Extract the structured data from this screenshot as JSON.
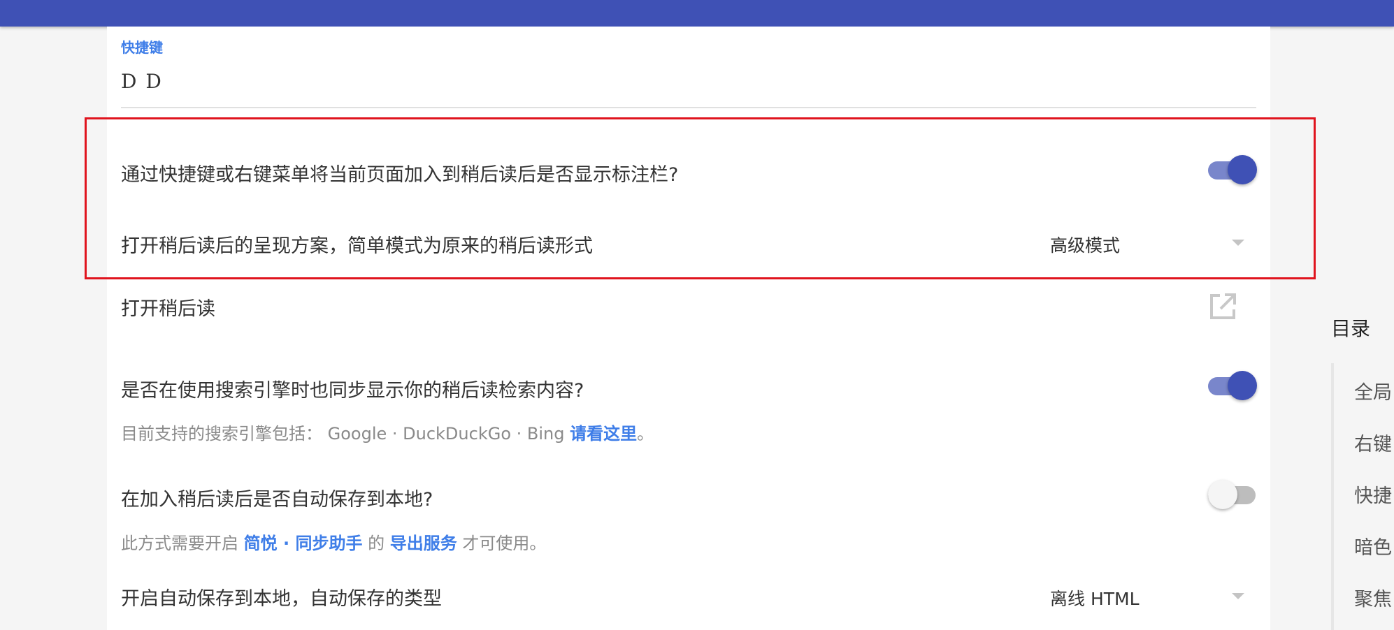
{
  "colors": {
    "header": "#3f51b5",
    "accent": "#3f7ee8",
    "highlight_border": "#e0141e",
    "toggle_on": "#3f51b5"
  },
  "shortcut": {
    "label": "快捷键",
    "value": "D D"
  },
  "settings": {
    "show_annotation_bar": {
      "label": "通过快捷键或右键菜单将当前页面加入到稍后读后是否显示标注栏?",
      "enabled": true
    },
    "present_mode": {
      "label": "打开稍后读后的呈现方案，简单模式为原来的稍后读形式",
      "selected": "高级模式"
    },
    "open_read_later": {
      "label": "打开稍后读",
      "icon": "open-external-icon"
    },
    "search_sync": {
      "label": "是否在使用搜索引擎时也同步显示你的稍后读检索内容?",
      "enabled": true,
      "desc_prefix": "目前支持的搜索引擎包括：  Google · DuckDuckGo · Bing ",
      "desc_link": "请看这里",
      "desc_suffix": "。"
    },
    "auto_save_local": {
      "label": "在加入稍后读后是否自动保存到本地?",
      "enabled": false,
      "desc_prefix": "此方式需要开启 ",
      "desc_link1": "简悦 · 同步助手",
      "desc_mid": " 的 ",
      "desc_link2": "导出服务",
      "desc_suffix": " 才可使用。"
    },
    "auto_save_type": {
      "label": "开启自动保存到本地，自动保存的类型",
      "selected": "离线 HTML"
    }
  },
  "toc": {
    "title": "目录",
    "items": [
      "全局",
      "右键",
      "快捷",
      "暗色",
      "聚焦"
    ]
  }
}
